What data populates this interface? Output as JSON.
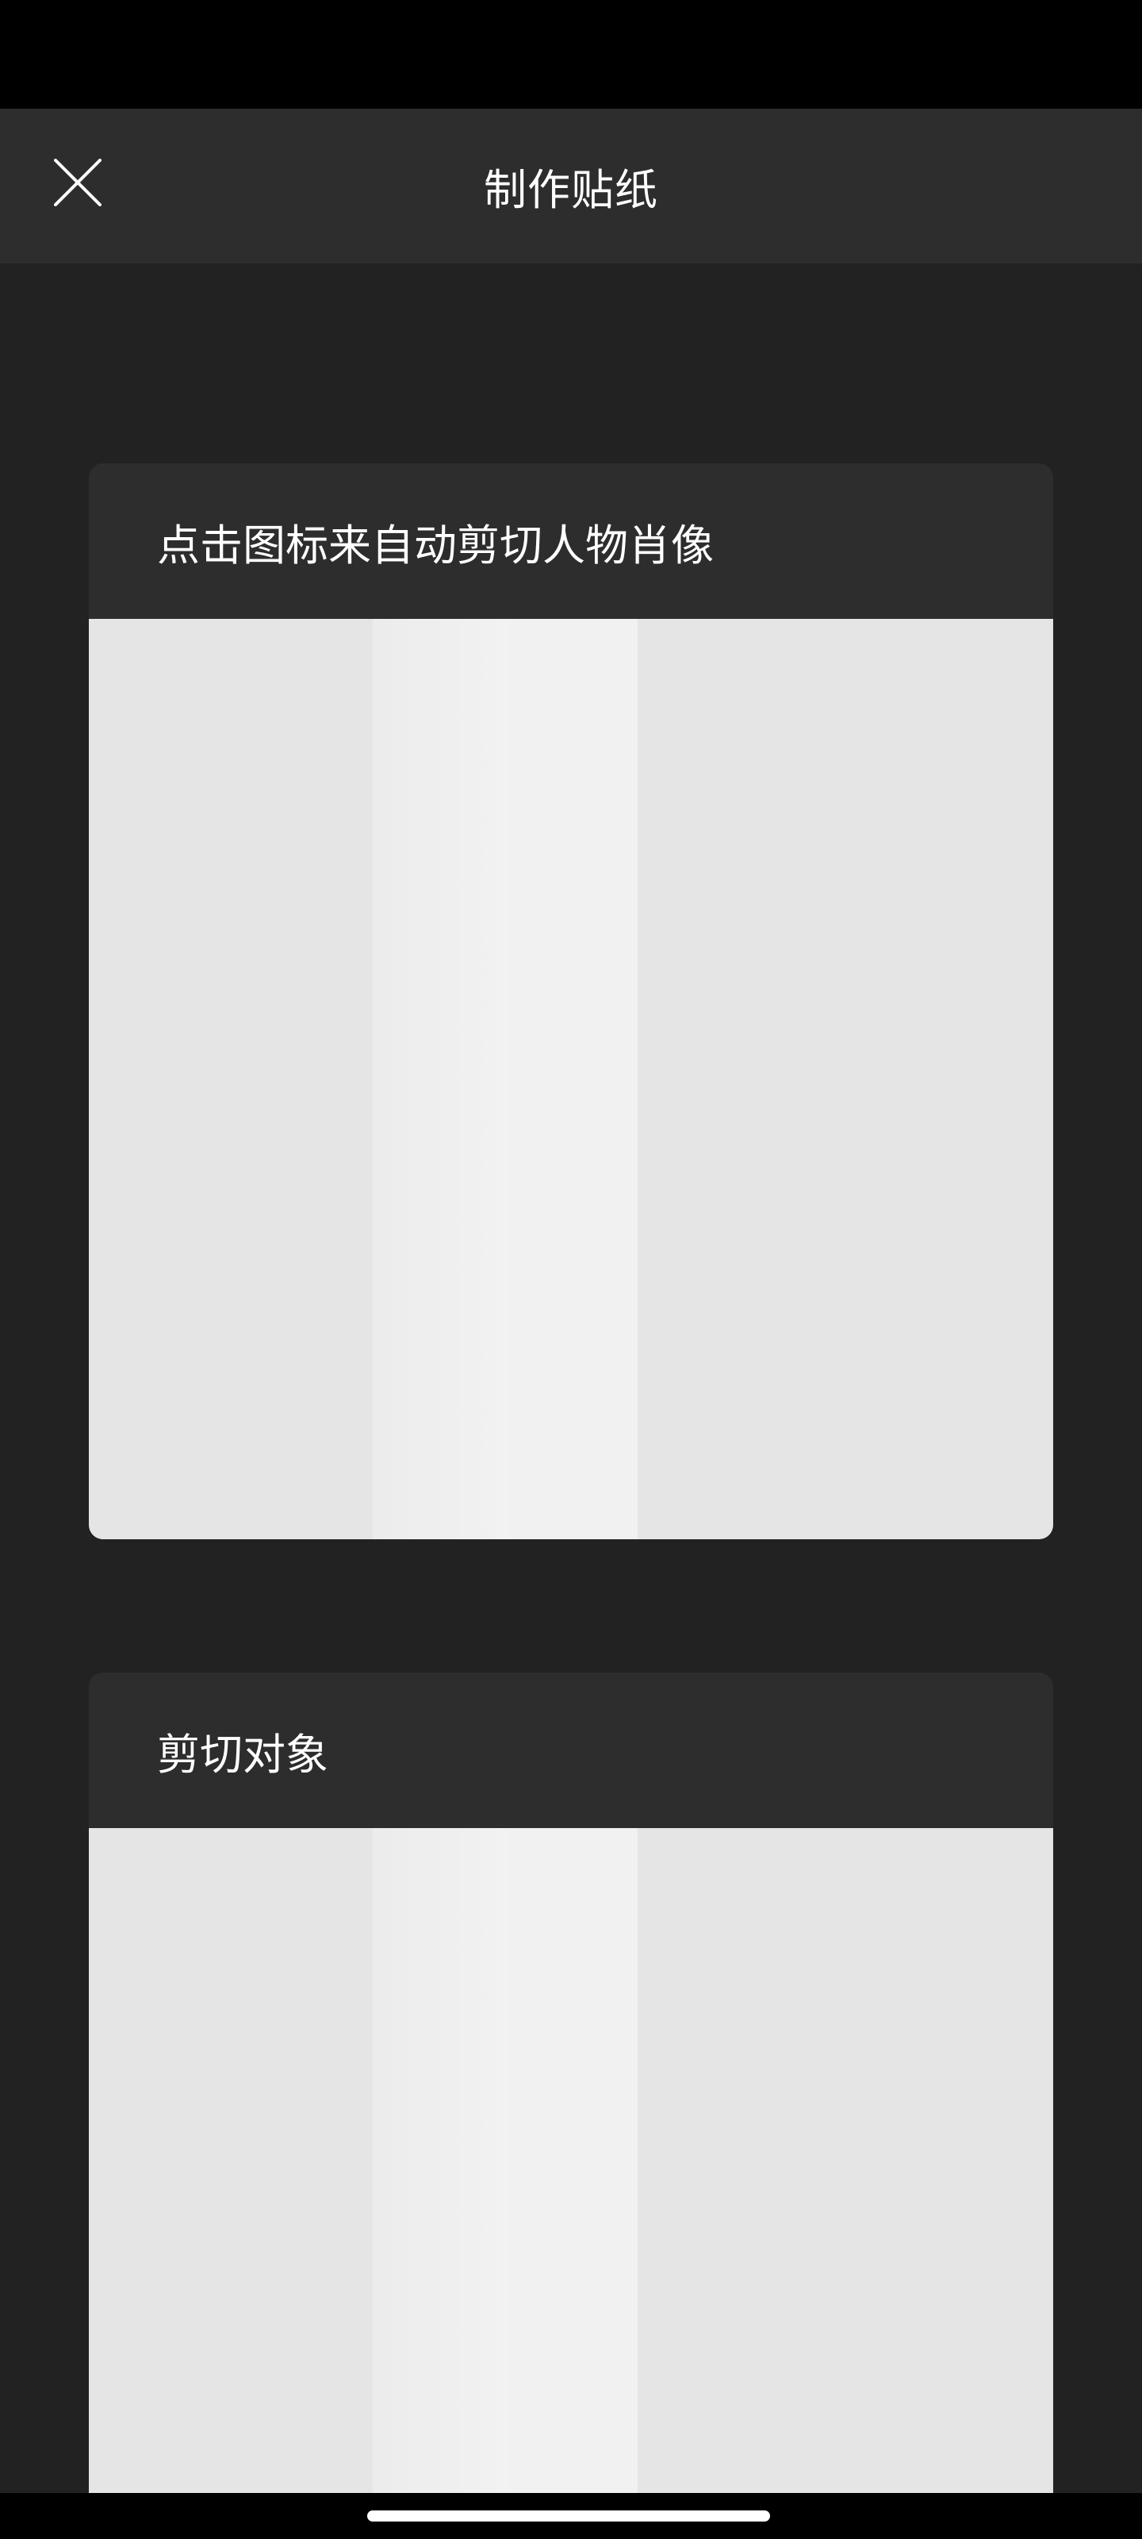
{
  "header": {
    "title": "制作贴纸",
    "close_icon": "close-icon"
  },
  "cards": [
    {
      "label": "点击图标来自动剪切人物肖像"
    },
    {
      "label": "剪切对象"
    }
  ],
  "colors": {
    "status_bar": "#000000",
    "header_bg": "#2d2d2d",
    "content_bg": "#222222",
    "card_header_bg": "#2d2d2d",
    "preview_bg": "#e5e5e5",
    "text": "#ffffff"
  }
}
